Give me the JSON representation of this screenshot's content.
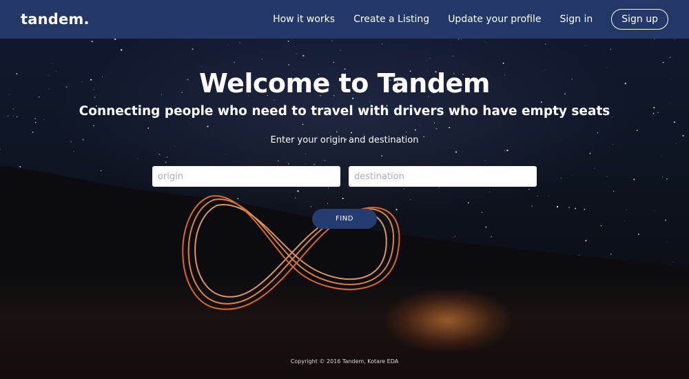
{
  "header": {
    "logo": "tandem.",
    "nav": {
      "how_it_works": "How it works",
      "create_listing": "Create a Listing",
      "update_profile": "Update your profile",
      "sign_in": "Sign in",
      "sign_up": "Sign up"
    }
  },
  "hero": {
    "title": "Welcome to Tandem",
    "subtitle": "Connecting people who need to travel with drivers who have empty seats",
    "prompt": "Enter your origin and destination"
  },
  "search": {
    "origin_placeholder": "origin",
    "destination_placeholder": "destination",
    "find_label": "FIND"
  },
  "footer": {
    "copyright": "Copyright © 2016 Tandem, Kotare EDA"
  },
  "colors": {
    "navbar": "#233866",
    "button": "#253c70",
    "sky": "#101a33"
  }
}
